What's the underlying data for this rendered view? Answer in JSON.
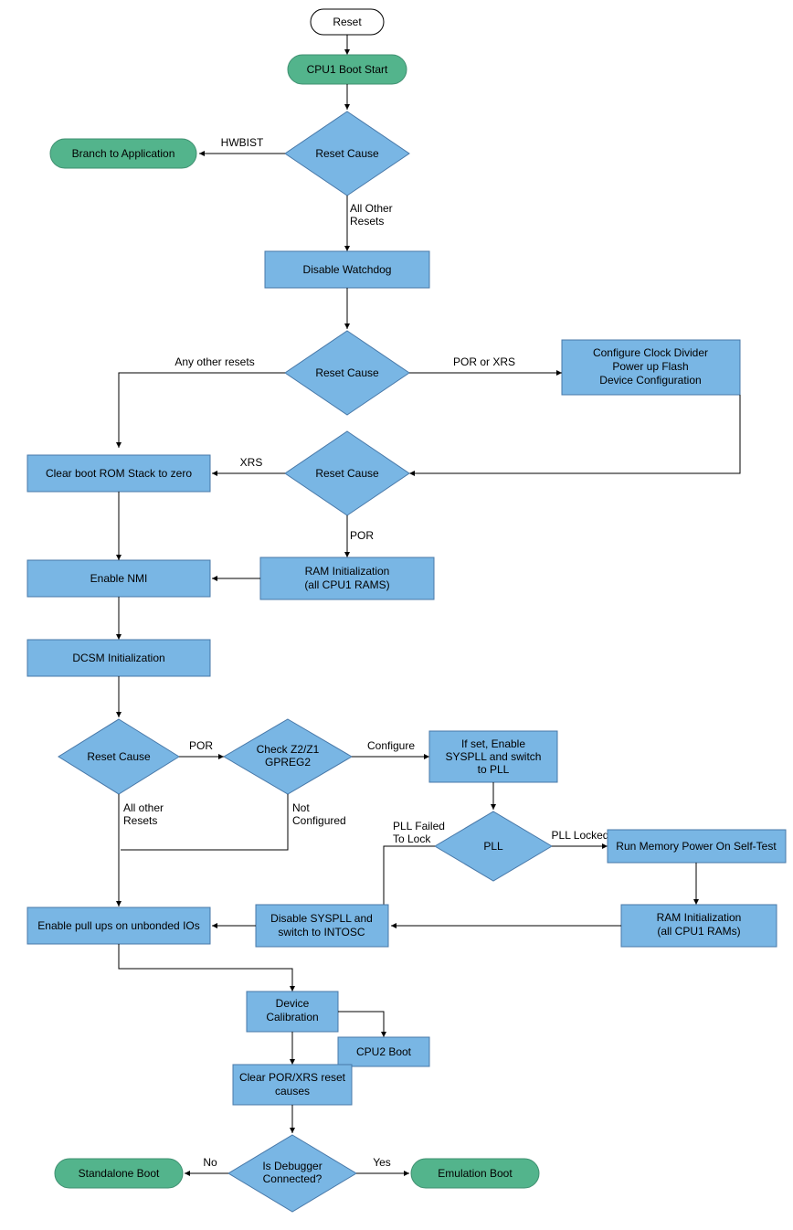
{
  "nodes": {
    "reset": "Reset",
    "cpu1_boot_start": "CPU1 Boot Start",
    "reset_cause_1": "Reset Cause",
    "branch_app": "Branch to Application",
    "disable_wdog": "Disable Watchdog",
    "reset_cause_2": "Reset Cause",
    "cfg_clock": {
      "l1": "Configure Clock Divider",
      "l2": "Power up Flash",
      "l3": "Device Configuration"
    },
    "reset_cause_3": "Reset Cause",
    "clear_stack": "Clear boot ROM Stack to zero",
    "ram_init_1": {
      "l1": "RAM Initialization",
      "l2": "(all CPU1 RAMS)"
    },
    "enable_nmi": "Enable NMI",
    "dcsm_init": "DCSM Initialization",
    "reset_cause_4": "Reset Cause",
    "check_gpreg": {
      "l1": "Check Z2/Z1",
      "l2": "GPREG2"
    },
    "syspll_enable": {
      "l1": "If set, Enable",
      "l2": "SYSPLL and switch",
      "l3": "to PLL"
    },
    "pll": "PLL",
    "mem_selftest": "Run Memory Power On Self-Test",
    "ram_init_2": {
      "l1": "RAM Initialization",
      "l2": "(all CPU1 RAMs)"
    },
    "disable_syspll": {
      "l1": "Disable SYSPLL and",
      "l2": "switch to INTOSC"
    },
    "enable_pullups": "Enable pull ups on unbonded IOs",
    "device_cal": {
      "l1": "Device",
      "l2": "Calibration"
    },
    "cpu2_boot": "CPU2 Boot",
    "clear_por_xrs": {
      "l1": "Clear POR/XRS reset",
      "l2": "causes"
    },
    "is_debugger": {
      "l1": "Is Debugger",
      "l2": "Connected?"
    },
    "standalone_boot": "Standalone Boot",
    "emulation_boot": "Emulation Boot"
  },
  "edges": {
    "hwbist": "HWBIST",
    "all_other_resets": {
      "l1": "All Other",
      "l2": "Resets"
    },
    "any_other_resets": "Any other resets",
    "por_or_xrs": "POR or XRS",
    "xrs": "XRS",
    "por": "POR",
    "por2": "POR",
    "all_other_resets2": {
      "l1": "All other",
      "l2": "Resets"
    },
    "configure": "Configure",
    "not_configured": {
      "l1": "Not",
      "l2": "Configured"
    },
    "pll_failed": {
      "l1": "PLL Failed",
      "l2": "To Lock"
    },
    "pll_locked": "PLL Locked",
    "no": "No",
    "yes": "Yes"
  }
}
